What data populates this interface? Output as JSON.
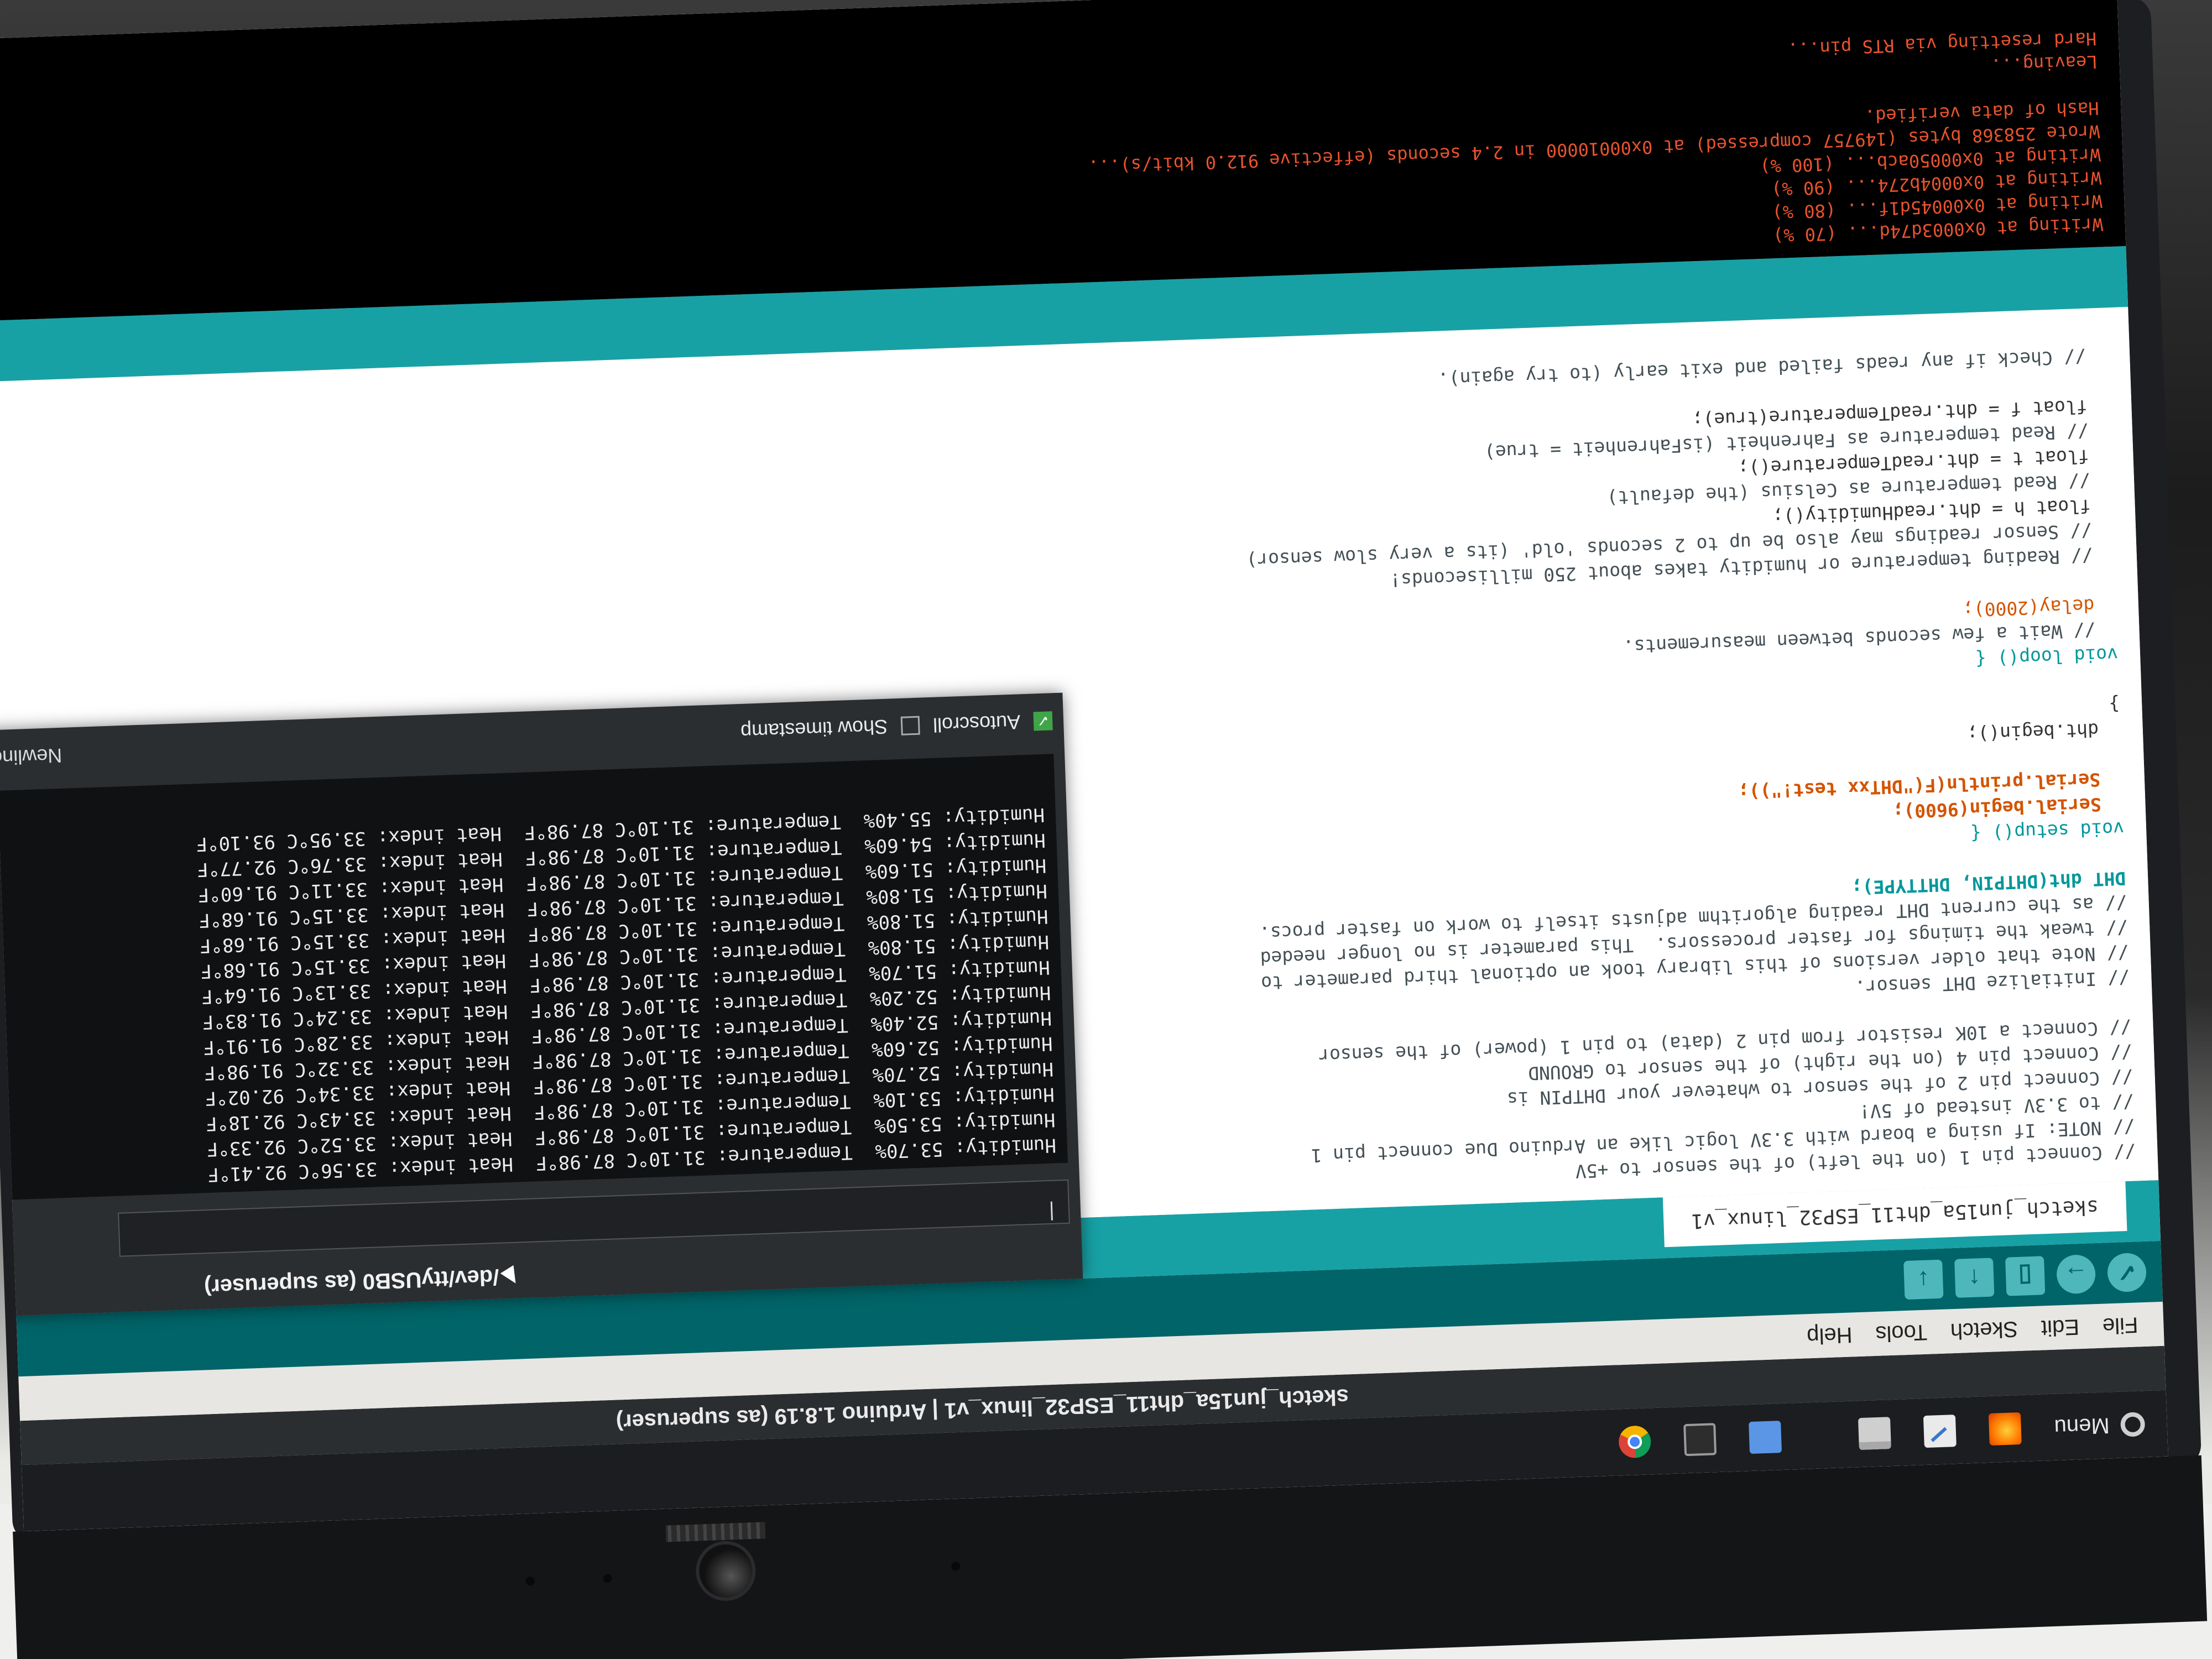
{
  "taskbar": {
    "menu_label": "Menu",
    "icons": [
      "gear-icon",
      "firefox-icon",
      "text-editor-icon",
      "terminal-icon",
      "files-icon",
      "system-monitor-icon",
      "chrome-icon"
    ]
  },
  "window": {
    "title": "sketch_jun15a_dht11_ESP32_linux_v1 | Arduino 1.8.19 (as superuser)"
  },
  "menubar": {
    "items": [
      "File",
      "Edit",
      "Sketch",
      "Tools",
      "Help"
    ]
  },
  "toolbar": {
    "verify_icon": "✓",
    "upload_icon": "→",
    "new_icon": "▯",
    "open_icon": "↑",
    "save_icon": "↓"
  },
  "tab": {
    "label": "sketch_jun15a_dht11_ESP32_linux_v1"
  },
  "code_lines": [
    {
      "cls": "c-comment",
      "text": "// Connect pin 1 (on the left) of the sensor to +5V"
    },
    {
      "cls": "c-comment",
      "text": "// NOTE: If using a board with 3.3V logic like an Arduino Due connect pin 1"
    },
    {
      "cls": "c-comment",
      "text": "// to 3.3V instead of 5V!"
    },
    {
      "cls": "c-comment",
      "text": "// Connect pin 2 of the sensor to whatever your DHTPIN is"
    },
    {
      "cls": "c-comment",
      "text": "// Connect pin 4 (on the right) of the sensor to GROUND"
    },
    {
      "cls": "c-comment",
      "text": "// Connect a 10K resistor from pin 2 (data) to pin 1 (power) of the sensor"
    },
    {
      "cls": "",
      "text": ""
    },
    {
      "cls": "c-comment",
      "text": "// Initialize DHT sensor."
    },
    {
      "cls": "c-comment",
      "text": "// Note that older versions of this library took an optional third parameter to"
    },
    {
      "cls": "c-comment",
      "text": "// tweak the timings for faster processors.  This parameter is no longer needed"
    },
    {
      "cls": "c-comment",
      "text": "// as the current DHT reading algorithm adjusts itself to work on faster procs."
    },
    {
      "cls": "c-type",
      "text": "DHT dht(DHTPIN, DHTTYPE);"
    },
    {
      "cls": "",
      "text": ""
    },
    {
      "cls": "c-kw",
      "text": "void setup() {"
    },
    {
      "cls": "c-ser",
      "text": "  Serial.begin(9600);"
    },
    {
      "cls": "c-ser",
      "text": "  Serial.println(F(\"DHTxx test!\"));"
    },
    {
      "cls": "",
      "text": ""
    },
    {
      "cls": "",
      "text": "  dht.begin();"
    },
    {
      "cls": "",
      "text": "}"
    },
    {
      "cls": "",
      "text": ""
    },
    {
      "cls": "c-kw",
      "text": "void loop() {"
    },
    {
      "cls": "c-comment",
      "text": "  // Wait a few seconds between measurements."
    },
    {
      "cls": "c-fn",
      "text": "  delay(2000);"
    },
    {
      "cls": "",
      "text": ""
    },
    {
      "cls": "c-comment",
      "text": "  // Reading temperature or humidity takes about 250 milliseconds!"
    },
    {
      "cls": "c-comment",
      "text": "  // Sensor readings may also be up to 2 seconds 'old' (its a very slow sensor)"
    },
    {
      "cls": "",
      "text": "  float h = dht.readHumidity();"
    },
    {
      "cls": "c-comment",
      "text": "  // Read temperature as Celsius (the default)"
    },
    {
      "cls": "",
      "text": "  float t = dht.readTemperature();"
    },
    {
      "cls": "c-comment",
      "text": "  // Read temperature as Fahrenheit (isFahrenheit = true)"
    },
    {
      "cls": "",
      "text": "  float f = dht.readTemperature(true);"
    },
    {
      "cls": "",
      "text": ""
    },
    {
      "cls": "c-comment",
      "text": "  // Check if any reads failed and exit early (to try again)."
    }
  ],
  "console_lines": [
    "Writing at 0x0003d74d... (70 %)",
    "Writing at 0x00045d1f... (80 %)",
    "Writing at 0x0004b274... (90 %)",
    "Writing at 0x00050acb... (100 %)",
    "Wrote 258368 bytes (149757 compressed) at 0x00010000 in 2.4 seconds (effective 912.0 kbit/s)...",
    "Hash of data verified.",
    "",
    "Leaving...",
    "Hard resetting via RTS pin..."
  ],
  "serial_monitor": {
    "title": "/dev/ttyUSB0 (as superuser)",
    "input_value": "|",
    "lines": [
      "Humidity: 53.70%  Temperature: 31.10°C 87.98°F  Heat index: 33.56°C 92.41°F",
      "Humidity: 53.50%  Temperature: 31.10°C 87.98°F  Heat index: 33.52°C 92.33°F",
      "Humidity: 53.10%  Temperature: 31.10°C 87.98°F  Heat index: 33.43°C 92.18°F",
      "Humidity: 52.70%  Temperature: 31.10°C 87.98°F  Heat index: 33.34°C 92.02°F",
      "Humidity: 52.60%  Temperature: 31.10°C 87.98°F  Heat index: 33.32°C 91.98°F",
      "Humidity: 52.40%  Temperature: 31.10°C 87.98°F  Heat index: 33.28°C 91.91°F",
      "Humidity: 52.20%  Temperature: 31.10°C 87.98°F  Heat index: 33.24°C 91.83°F",
      "Humidity: 51.70%  Temperature: 31.10°C 87.98°F  Heat index: 33.13°C 91.64°F",
      "Humidity: 51.80%  Temperature: 31.10°C 87.98°F  Heat index: 33.15°C 91.68°F",
      "Humidity: 51.80%  Temperature: 31.10°C 87.98°F  Heat index: 33.15°C 91.68°F",
      "Humidity: 51.80%  Temperature: 31.10°C 87.98°F  Heat index: 33.15°C 91.68°F",
      "Humidity: 51.60%  Temperature: 31.10°C 87.98°F  Heat index: 33.11°C 91.60°F",
      "Humidity: 54.60%  Temperature: 31.10°C 87.98°F  Heat index: 33.76°C 92.77°F",
      "Humidity: 55.40%  Temperature: 31.10°C 87.98°F  Heat index: 33.95°C 93.10°F"
    ],
    "autoscroll_label": "Autoscroll",
    "autoscroll_checked": true,
    "timestamp_label": "Show timestamp",
    "timestamp_checked": false,
    "line_ending": "Newline"
  }
}
